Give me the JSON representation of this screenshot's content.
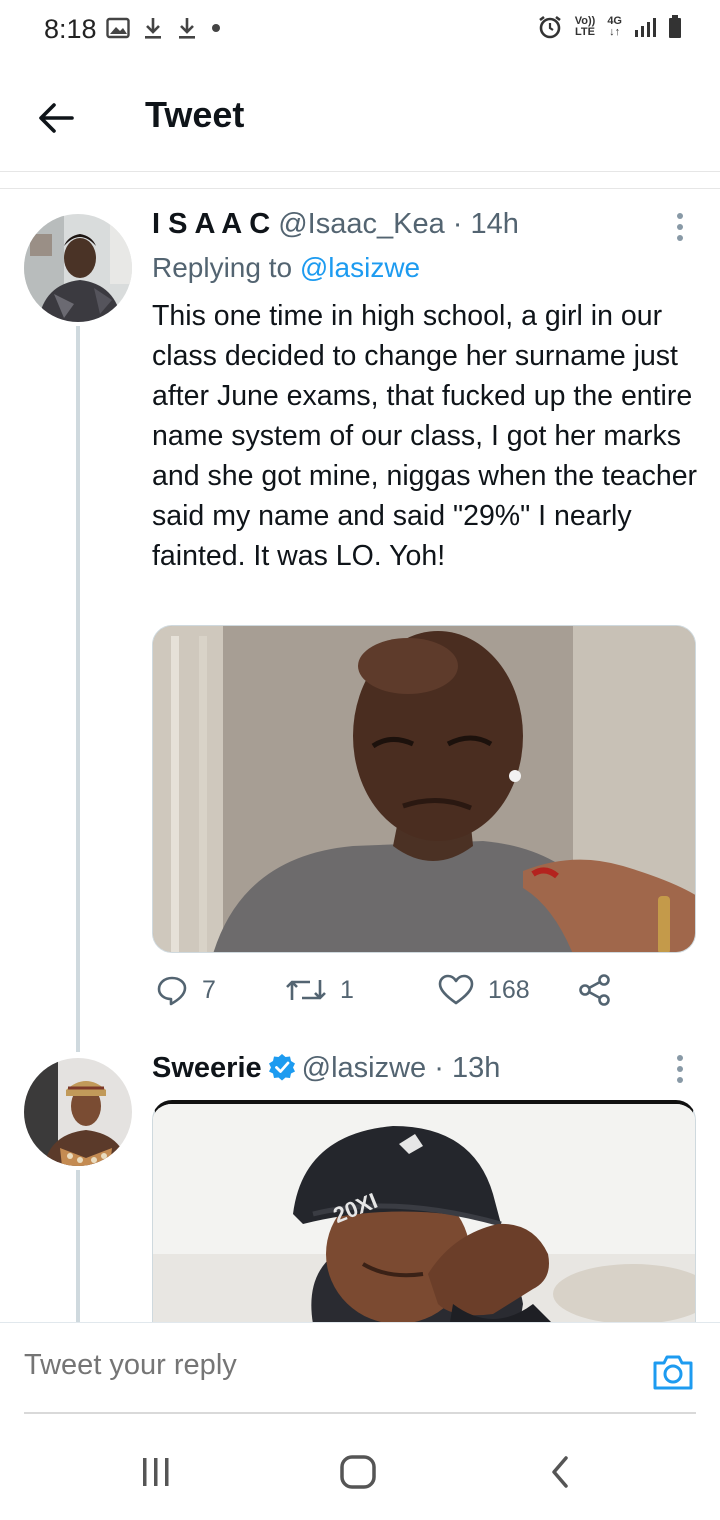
{
  "status_bar": {
    "time": "8:18",
    "volte_top": "Vo))",
    "volte_bottom": "LTE",
    "network": "4G",
    "icons": [
      "image-icon",
      "download-icon",
      "download-icon",
      "dot-icon",
      "alarm-icon",
      "signal-icon",
      "battery-icon"
    ]
  },
  "header": {
    "title": "Tweet",
    "back_icon": "arrow-left-icon"
  },
  "tweets": [
    {
      "name": "I S A A C",
      "handle": "@Isaac_Kea",
      "time": "· 14h",
      "replying_prefix": "Replying to",
      "replying_to": "@lasizwe",
      "text": "This one time in high school, a girl in our class decided to change her surname just after June exams, that fucked up the entire name system of our class, I got her marks and she got mine, niggas when the teacher said my name and said \"29%\" I nearly fainted. It was LO. Yoh!",
      "actions": {
        "replies": "7",
        "retweets": "1",
        "likes": "168"
      }
    },
    {
      "name": "Sweerie",
      "verified": true,
      "handle": "@lasizwe",
      "time": "· 13h",
      "cap_text": "20XI"
    }
  ],
  "composer": {
    "placeholder": "Tweet your reply"
  },
  "colors": {
    "accent": "#1d9bf0",
    "text_primary": "#0f1419",
    "text_secondary": "#536471",
    "thread_line": "#cfd9de"
  }
}
